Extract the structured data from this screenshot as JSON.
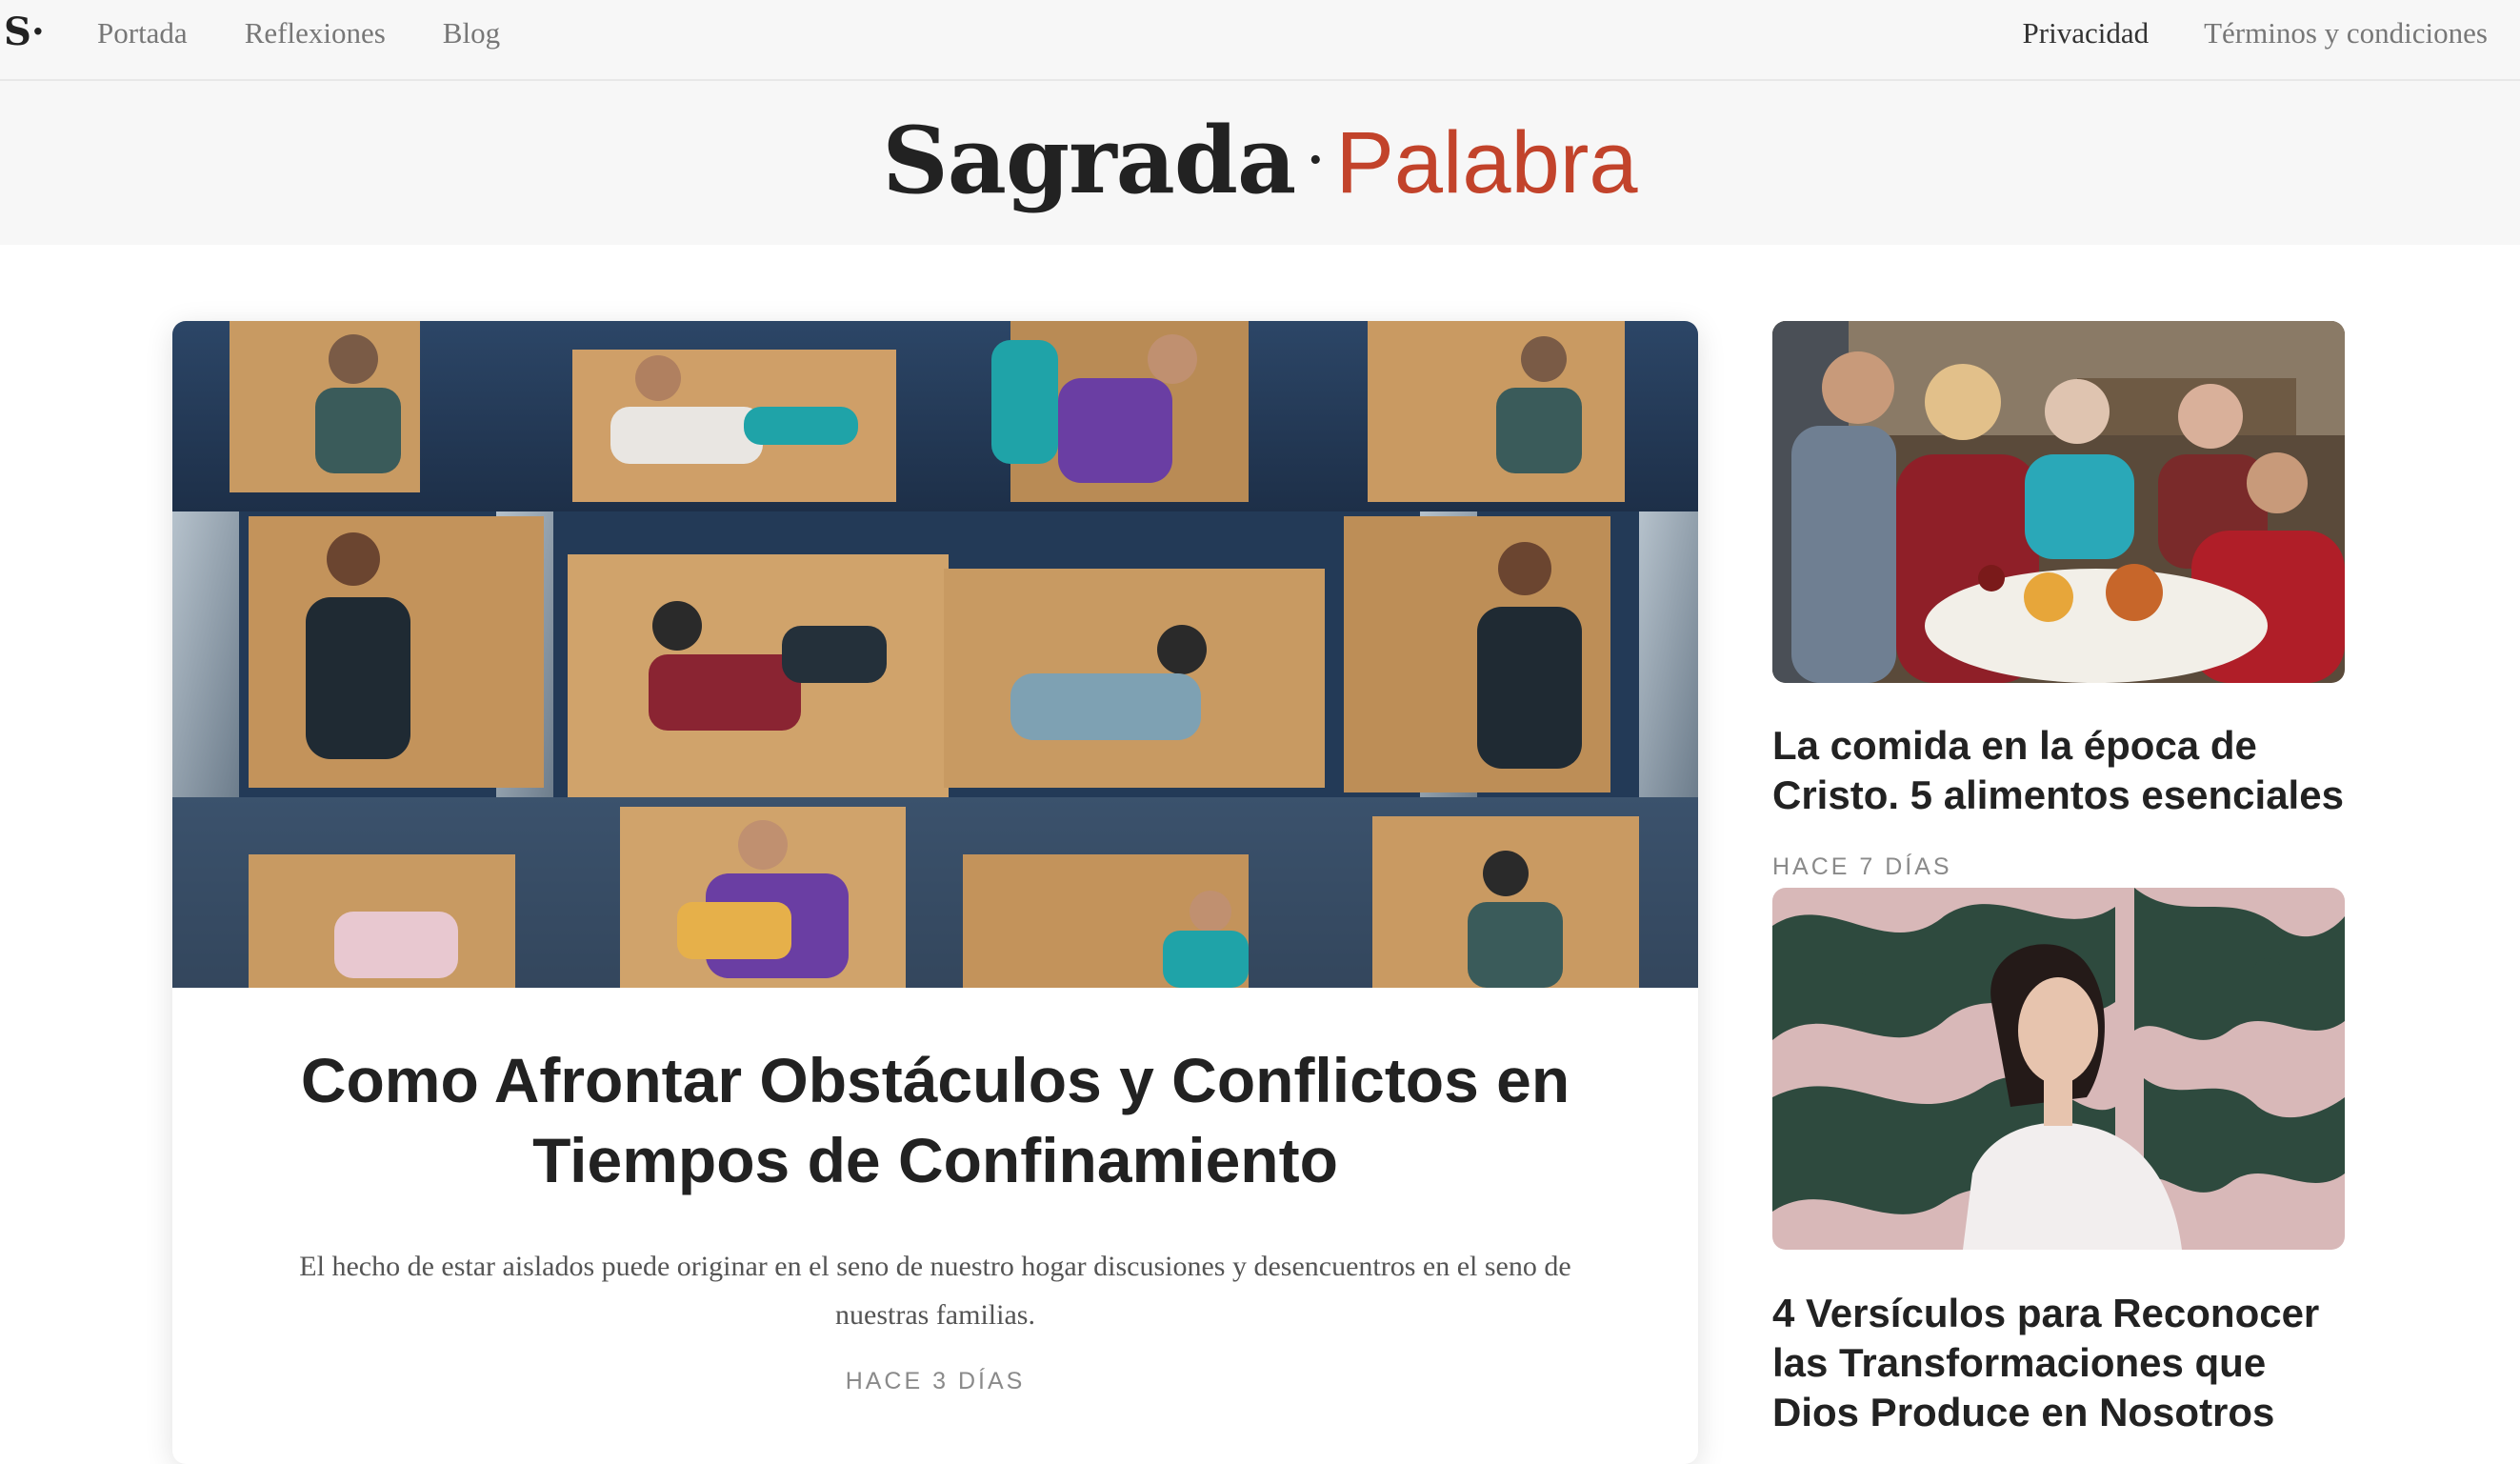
{
  "nav": {
    "brand_mark": "S·",
    "left_items": [
      "Portada",
      "Reflexiones",
      "Blog"
    ],
    "right_items": [
      "Privacidad",
      "Términos y condiciones"
    ]
  },
  "masthead": {
    "word1": "Sagrada",
    "separator": "·",
    "word2": "Palabra"
  },
  "featured": {
    "image_icon": "people-in-boxes-collage",
    "title": "Como Afrontar Obstáculos y Conflictos en Tiempos de Confinamiento",
    "excerpt": "El hecho de estar aislados puede originar en el seno de nuestro hogar discusiones y desencuentros en el seno de nuestras familias.",
    "time": "HACE 3 DÍAS"
  },
  "sidebar": [
    {
      "image_icon": "family-praying-at-dinner-photo",
      "title": "La comida en la época de Cristo. 5 alimentos esenciales",
      "time": "HACE 7 DÍAS"
    },
    {
      "image_icon": "woman-against-mural-photo",
      "title": "4 Versículos para Reconocer las Transformaciones que Dios Produce en Nosotros"
    }
  ],
  "colors": {
    "accent": "#c2432b",
    "nav_bg": "#f7f7f7",
    "text": "#222222",
    "muted": "#8a8a8a"
  }
}
